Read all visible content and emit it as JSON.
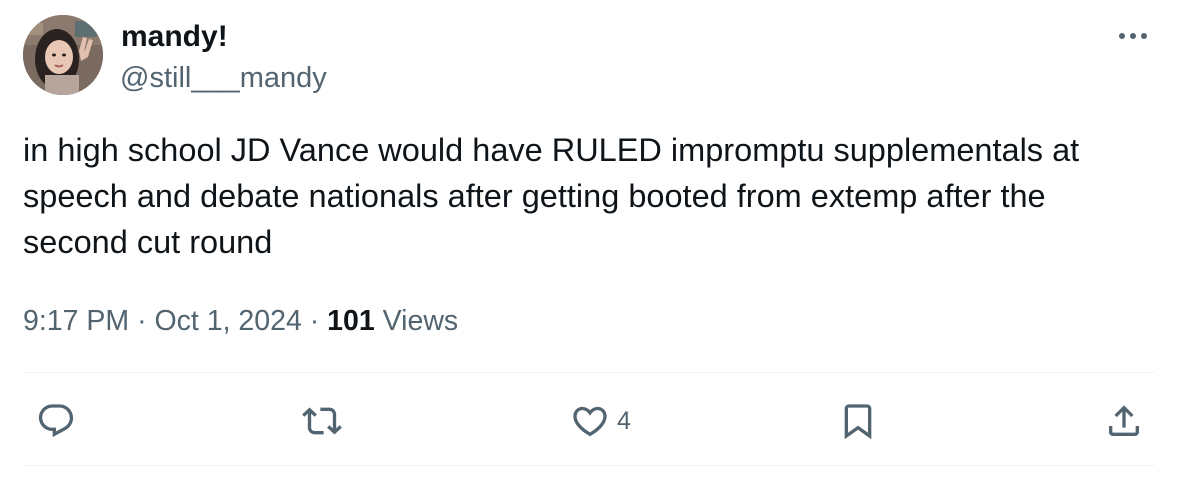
{
  "author": {
    "display_name": "mandy!",
    "handle": "@still___mandy"
  },
  "tweet": {
    "text": "in high school JD Vance would have RULED impromptu supplementals at speech and debate nationals after getting booted from extemp after the second cut round"
  },
  "meta": {
    "time": "9:17 PM",
    "separator": "·",
    "date": "Oct 1, 2024",
    "views_count": "101",
    "views_label": "Views"
  },
  "actions": {
    "reply_icon": "reply-icon",
    "retweet_icon": "retweet-icon",
    "like_icon": "heart-icon",
    "like_count": "4",
    "bookmark_icon": "bookmark-icon",
    "share_icon": "share-icon"
  },
  "colors": {
    "text_primary": "#0f1419",
    "text_secondary": "#536471",
    "divider": "#eff3f4"
  }
}
